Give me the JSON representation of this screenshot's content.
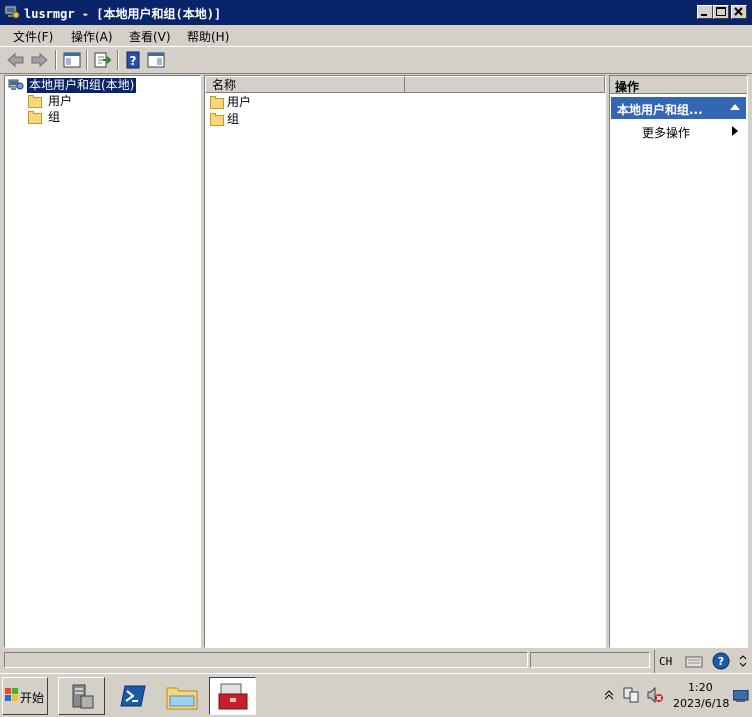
{
  "window": {
    "title": "lusrmgr - [本地用户和组(本地)]"
  },
  "menu": {
    "items": [
      "文件(F)",
      "操作(A)",
      "查看(V)",
      "帮助(H)"
    ]
  },
  "tree": {
    "root": "本地用户和组(本地)",
    "children": [
      "用户",
      "组"
    ]
  },
  "list": {
    "columns": [
      "名称",
      ""
    ],
    "rows": [
      "用户",
      "组"
    ]
  },
  "actions": {
    "header": "操作",
    "section_title": "本地用户和组...",
    "items": [
      "更多操作"
    ]
  },
  "taskbar": {
    "start_label": "开始",
    "tray_lang": "CH",
    "clock_time": "1:20",
    "clock_date": "2023/6/18"
  },
  "colors": {
    "titlebar": "#0a246a",
    "selection": "#0a246a",
    "action_section": "#3366b3",
    "window_face": "#d4d0c8"
  }
}
